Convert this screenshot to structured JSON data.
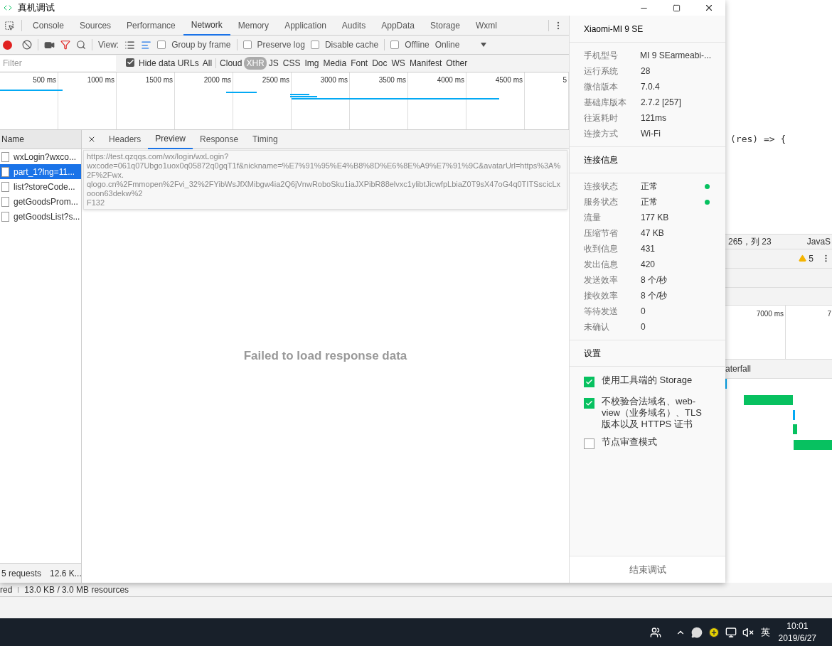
{
  "window": {
    "title": "真机调试"
  },
  "devtools": {
    "tabs": [
      {
        "label": "Console",
        "selected": false
      },
      {
        "label": "Sources",
        "selected": false
      },
      {
        "label": "Performance",
        "selected": false
      },
      {
        "label": "Network",
        "selected": true
      },
      {
        "label": "Memory",
        "selected": false
      },
      {
        "label": "Application",
        "selected": false
      },
      {
        "label": "Audits",
        "selected": false
      },
      {
        "label": "AppData",
        "selected": false
      },
      {
        "label": "Storage",
        "selected": false
      },
      {
        "label": "Wxml",
        "selected": false
      }
    ],
    "toolbar": {
      "recording": true,
      "view_label": "View:",
      "options": [
        {
          "label": "Group by frame",
          "checked": false
        },
        {
          "label": "Preserve log",
          "checked": false
        },
        {
          "label": "Disable cache",
          "checked": false
        },
        {
          "label": "Offline",
          "checked": false
        }
      ],
      "throttle": "Online"
    },
    "filter": {
      "placeholder": "Filter",
      "hide_data_urls": {
        "label": "Hide data URLs",
        "checked": true
      },
      "types": [
        {
          "label": "All",
          "selected": false
        },
        {
          "label": "Cloud",
          "selected": false
        },
        {
          "label": "XHR",
          "selected": true
        },
        {
          "label": "JS",
          "selected": false
        },
        {
          "label": "CSS",
          "selected": false
        },
        {
          "label": "Img",
          "selected": false
        },
        {
          "label": "Media",
          "selected": false
        },
        {
          "label": "Font",
          "selected": false
        },
        {
          "label": "Doc",
          "selected": false
        },
        {
          "label": "WS",
          "selected": false
        },
        {
          "label": "Manifest",
          "selected": false
        },
        {
          "label": "Other",
          "selected": false
        }
      ]
    },
    "timeline": {
      "ticks": [
        "500 ms",
        "1000 ms",
        "1500 ms",
        "2000 ms",
        "2500 ms",
        "3000 ms",
        "3500 ms",
        "4000 ms",
        "4500 ms",
        "5"
      ]
    },
    "requests": {
      "header": "Name",
      "rows": [
        {
          "name": "wxLogin?wxco...",
          "selected": false
        },
        {
          "name": "part_1?lng=11...",
          "selected": true
        },
        {
          "name": "list?storeCode...",
          "selected": false
        },
        {
          "name": "getGoodsProm...",
          "selected": false
        },
        {
          "name": "getGoodsList?s...",
          "selected": false
        }
      ]
    },
    "detail": {
      "tabs": [
        {
          "label": "Headers",
          "selected": false
        },
        {
          "label": "Preview",
          "selected": true
        },
        {
          "label": "Response",
          "selected": false
        },
        {
          "label": "Timing",
          "selected": false
        }
      ],
      "message": "Failed to load response data"
    },
    "tooltip": {
      "lines": [
        "https://test.qzqqs.com/wx/login/wxLogin?",
        "wxcode=061q07Ubgo1uox0q05872q0gqT1f&nickname=%E7%91%95%E4%B8%8D%E6%8E%A9%E7%91%9C&avatarUrl=https%3A%2F%2Fwx.",
        "qlogo.cn%2Fmmopen%2Fvi_32%2FYibWsJfXMibgw4ia2Q6jVnwRoboSku1iaJXPibR88elvxc1ylibtJicwfpLbiaZ0T9sX47oG4q0TITSscicLxooon63dekw%2",
        "F132"
      ]
    },
    "summary": [
      "5 requests",
      "12.6 K..."
    ]
  },
  "device_panel": {
    "title": "Xiaomi-MI 9 SE",
    "info": [
      {
        "label": "手机型号",
        "value": "MI 9 SEarmeabi-..."
      },
      {
        "label": "运行系统",
        "value": "28"
      },
      {
        "label": "微信版本",
        "value": "7.0.4"
      },
      {
        "label": "基础库版本",
        "value": "2.7.2 [257]"
      },
      {
        "label": "往返耗时",
        "value": "121ms"
      },
      {
        "label": "连接方式",
        "value": "Wi-Fi"
      }
    ],
    "connection": {
      "title": "连接信息",
      "rows": [
        {
          "label": "连接状态",
          "value": "正常",
          "ok": true
        },
        {
          "label": "服务状态",
          "value": "正常",
          "ok": true
        },
        {
          "label": "流量",
          "value": "177 KB",
          "ok": false
        },
        {
          "label": "压缩节省",
          "value": "47 KB",
          "ok": false
        },
        {
          "label": "收到信息",
          "value": "431",
          "ok": false
        },
        {
          "label": "发出信息",
          "value": "420",
          "ok": false
        },
        {
          "label": "发送效率",
          "value": "8 个/秒",
          "ok": false
        },
        {
          "label": "接收效率",
          "value": "8 个/秒",
          "ok": false
        },
        {
          "label": "等待发送",
          "value": "0",
          "ok": false
        },
        {
          "label": "未确认",
          "value": "0",
          "ok": false
        }
      ]
    },
    "settings": {
      "title": "设置",
      "options": [
        {
          "label": "使用工具端的 Storage",
          "checked": true
        },
        {
          "label": "不校验合法域名、web-view（业务域名）、TLS 版本以及 HTTPS 证书",
          "checked": true
        },
        {
          "label": "节点审查模式",
          "checked": false
        }
      ]
    },
    "end_button": "结束调试"
  },
  "background_editor": {
    "code": "(res) => {",
    "cursor": "265，列 23",
    "language": "JavaS",
    "warnings": "5",
    "ruler": [
      "7000 ms",
      "7"
    ],
    "waterfall_tab": "aterfall"
  },
  "status_bar": [
    "red",
    "13.0 KB / 3.0 MB resources"
  ],
  "taskbar": {
    "input_method": "英",
    "time": "10:01",
    "date": "2019/6/27"
  }
}
